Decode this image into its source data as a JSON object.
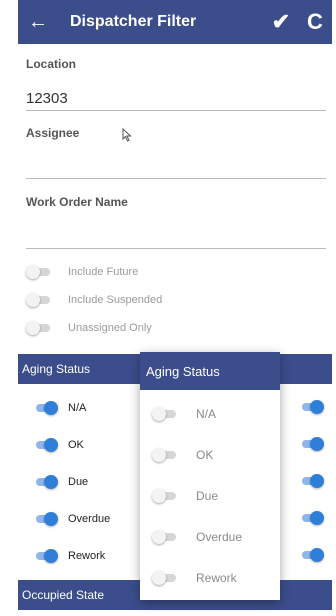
{
  "header": {
    "title": "Dispatcher Filter",
    "back_icon": "←",
    "check_icon": "✔",
    "refresh_icon": "C"
  },
  "form": {
    "location_label": "Location",
    "location_value": "12303",
    "assignee_label": "Assignee",
    "assignee_value": "",
    "work_order_label": "Work Order Name",
    "work_order_value": "",
    "toggles": [
      {
        "label": "Include Future",
        "on": false
      },
      {
        "label": "Include Suspended",
        "on": false
      },
      {
        "label": "Unassigned Only",
        "on": false
      }
    ]
  },
  "aging": {
    "section_label": "Aging Status",
    "items": [
      {
        "label": "N/A",
        "on": true
      },
      {
        "label": "OK",
        "on": true
      },
      {
        "label": "Due",
        "on": true
      },
      {
        "label": "Overdue",
        "on": true
      },
      {
        "label": "Rework",
        "on": true
      }
    ]
  },
  "popup": {
    "title": "Aging Status",
    "items": [
      {
        "label": "N/A",
        "on": false
      },
      {
        "label": "OK",
        "on": false
      },
      {
        "label": "Due",
        "on": false
      },
      {
        "label": "Overdue",
        "on": false
      },
      {
        "label": "Rework",
        "on": false
      }
    ]
  },
  "occupied": {
    "section_label": "Occupied State"
  },
  "colors": {
    "header_bg": "#3c4d8c",
    "toggle_on": "#2f7fd8"
  }
}
